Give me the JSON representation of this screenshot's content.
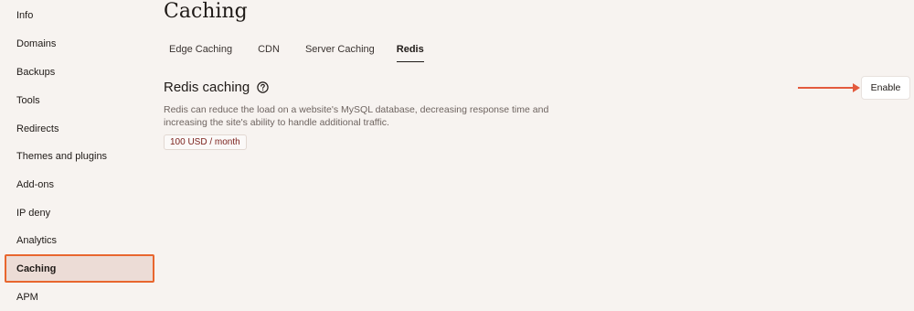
{
  "sidebar": {
    "items": [
      {
        "label": "Info",
        "active": false
      },
      {
        "label": "Domains",
        "active": false
      },
      {
        "label": "Backups",
        "active": false
      },
      {
        "label": "Tools",
        "active": false
      },
      {
        "label": "Redirects",
        "active": false
      },
      {
        "label": "Themes and plugins",
        "active": false
      },
      {
        "label": "Add-ons",
        "active": false
      },
      {
        "label": "IP deny",
        "active": false
      },
      {
        "label": "Analytics",
        "active": false
      },
      {
        "label": "Caching",
        "active": true
      },
      {
        "label": "APM",
        "active": false
      }
    ]
  },
  "page": {
    "title": "Caching"
  },
  "tabs": [
    {
      "label": "Edge Caching",
      "active": false
    },
    {
      "label": "CDN",
      "active": false
    },
    {
      "label": "Server Caching",
      "active": false
    },
    {
      "label": "Redis",
      "active": true
    }
  ],
  "section": {
    "title": "Redis caching",
    "help_icon": "question-circle-icon",
    "description": "Redis can reduce the load on a website's MySQL database, decreasing response time and increasing the site's ability to handle additional traffic.",
    "price": "100 USD / month"
  },
  "actions": {
    "enable_label": "Enable"
  },
  "colors": {
    "accent_orange": "#e8662e",
    "arrow_red": "#e35a3d",
    "active_bg": "#ecdcd6",
    "background": "#f7f3f0",
    "price_text": "#7a1f1a"
  }
}
